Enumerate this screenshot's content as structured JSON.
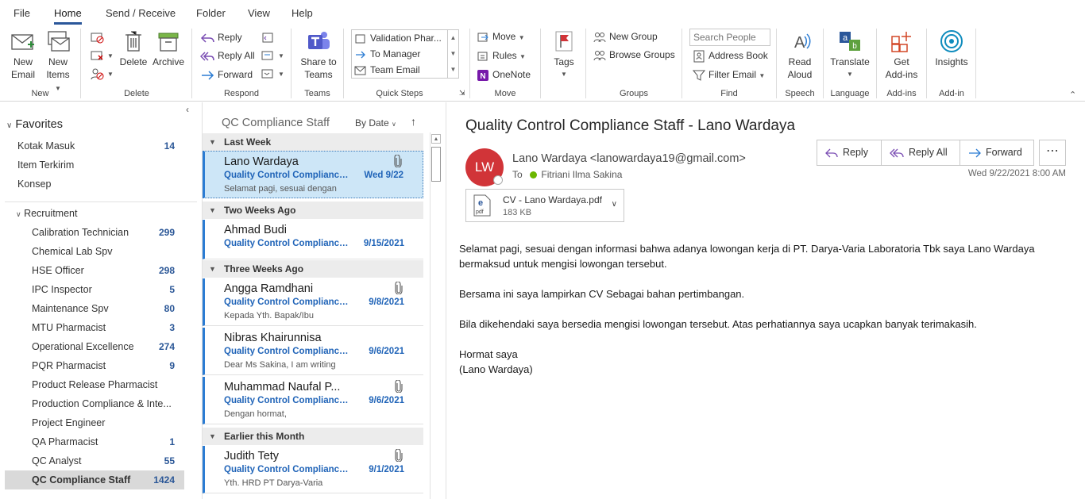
{
  "menu": {
    "tabs": [
      "File",
      "Home",
      "Send / Receive",
      "Folder",
      "View",
      "Help"
    ]
  },
  "ribbon": {
    "new": {
      "new_email": "New Email",
      "new_email_l1": "New",
      "new_email_l2": "Email",
      "new_items_l1": "New",
      "new_items_l2": "Items",
      "group": "New"
    },
    "delete": {
      "delete": "Delete",
      "archive": "Archive",
      "group": "Delete"
    },
    "respond": {
      "reply": "Reply",
      "reply_all": "Reply All",
      "forward": "Forward",
      "group": "Respond"
    },
    "teams": {
      "share_l1": "Share to",
      "share_l2": "Teams",
      "group": "Teams"
    },
    "quicksteps": {
      "items": [
        "Validation Phar...",
        "To Manager",
        "Team Email"
      ],
      "group": "Quick Steps"
    },
    "move": {
      "move": "Move",
      "rules": "Rules",
      "onenote": "OneNote",
      "group": "Move"
    },
    "tags": {
      "tags": "Tags"
    },
    "groups": {
      "new_group": "New Group",
      "browse_groups": "Browse Groups",
      "group": "Groups"
    },
    "find": {
      "search_placeholder": "Search People",
      "address_book": "Address Book",
      "filter_email": "Filter Email",
      "group": "Find"
    },
    "speech": {
      "read_l1": "Read",
      "read_l2": "Aloud",
      "group": "Speech"
    },
    "language": {
      "translate": "Translate",
      "group": "Language"
    },
    "addins": {
      "get_l1": "Get",
      "get_l2": "Add-ins",
      "group": "Add-ins"
    },
    "addin": {
      "insights": "Insights",
      "group": "Add-in"
    }
  },
  "folders": {
    "favorites_label": "Favorites",
    "favorites": [
      {
        "name": "Kotak Masuk",
        "count": "14"
      },
      {
        "name": "Item Terkirim",
        "count": ""
      },
      {
        "name": "Konsep",
        "count": ""
      }
    ],
    "recruitment_label": "Recruitment",
    "recruitment": [
      {
        "name": "Calibration Technician",
        "count": "299"
      },
      {
        "name": "Chemical Lab Spv",
        "count": ""
      },
      {
        "name": "HSE Officer",
        "count": "298"
      },
      {
        "name": "IPC Inspector",
        "count": "5"
      },
      {
        "name": "Maintenance Spv",
        "count": "80"
      },
      {
        "name": "MTU Pharmacist",
        "count": "3"
      },
      {
        "name": "Operational Excellence",
        "count": "274"
      },
      {
        "name": "PQR Pharmacist",
        "count": "9"
      },
      {
        "name": "Product Release Pharmacist",
        "count": ""
      },
      {
        "name": "Production Compliance & Inte...",
        "count": ""
      },
      {
        "name": "Project Engineer",
        "count": ""
      },
      {
        "name": "QA Pharmacist",
        "count": "1"
      },
      {
        "name": "QC Analyst",
        "count": "55"
      },
      {
        "name": "QC Compliance Staff",
        "count": "1424"
      }
    ]
  },
  "list": {
    "folder_title": "QC Compliance Staff",
    "sort": "By Date",
    "groups": [
      {
        "label": "Last Week"
      },
      {
        "label": "Two Weeks Ago"
      },
      {
        "label": "Three Weeks Ago"
      },
      {
        "label": "Earlier this Month"
      }
    ],
    "items": [
      {
        "from": "Lano Wardaya",
        "subject": "Quality Control Compliance...",
        "date": "Wed 9/22",
        "preview": "Selamat pagi, sesuai dengan"
      },
      {
        "from": "Ahmad Budi",
        "subject": "Quality Control Compliance...",
        "date": "9/15/2021",
        "preview": ""
      },
      {
        "from": "Angga Ramdhani",
        "subject": "Quality Control Compliance...",
        "date": "9/8/2021",
        "preview": "Kepada Yth.  Bapak/Ibu"
      },
      {
        "from": "Nibras Khairunnisa",
        "subject": "Quality Control Compliance...",
        "date": "9/6/2021",
        "preview": "Dear Ms Sakina,  I am writing"
      },
      {
        "from": "Muhammad Naufal P...",
        "subject": "Quality Control Compliance...",
        "date": "9/6/2021",
        "preview": "Dengan hormat,"
      },
      {
        "from": "Judith Tety",
        "subject": "Quality Control Compliance...",
        "date": "9/1/2021",
        "preview": "Yth.  HRD PT Darya-Varia"
      }
    ]
  },
  "email": {
    "subject": "Quality Control Compliance Staff - Lano Wardaya",
    "initials": "LW",
    "sender": "Lano Wardaya <lanowardaya19@gmail.com>",
    "to_label": "To",
    "to": "Fitriani Ilma Sakina",
    "datetime": "Wed 9/22/2021 8:00 AM",
    "reply": "Reply",
    "reply_all": "Reply All",
    "forward": "Forward",
    "attachment_name": "CV - Lano Wardaya.pdf",
    "attachment_size": "183 KB",
    "body": [
      "Selamat pagi, sesuai dengan informasi bahwa adanya lowongan kerja di PT. Darya-Varia Laboratoria Tbk saya Lano Wardaya",
      "bermaksud untuk mengisi lowongan tersebut.",
      "Bersama ini saya lampirkan CV Sebagai bahan pertimbangan.",
      "Bila dikehendaki saya bersedia mengisi lowongan tersebut. Atas perhatiannya saya ucapkan banyak terimakasih.",
      "Hormat saya",
      "(Lano Wardaya)"
    ]
  },
  "colors": {
    "accent": "#2b579a",
    "link_blue": "#2064b8",
    "avatar": "#d13438",
    "selected": "#cde6f7"
  }
}
